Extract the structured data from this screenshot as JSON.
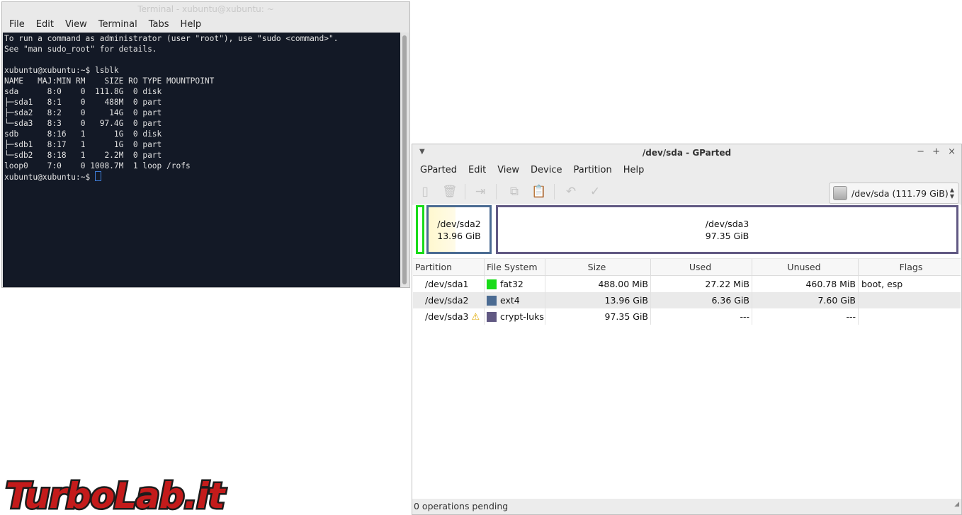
{
  "terminal": {
    "title": "Terminal - xubuntu@xubuntu: ~",
    "menu": [
      "File",
      "Edit",
      "View",
      "Terminal",
      "Tabs",
      "Help"
    ],
    "lines": [
      "To run a command as administrator (user \"root\"), use \"sudo <command>\".",
      "See \"man sudo_root\" for details.",
      "",
      "xubuntu@xubuntu:~$ lsblk",
      "NAME   MAJ:MIN RM    SIZE RO TYPE MOUNTPOINT",
      "sda      8:0    0  111.8G  0 disk",
      "├─sda1   8:1    0    488M  0 part",
      "├─sda2   8:2    0     14G  0 part",
      "└─sda3   8:3    0   97.4G  0 part",
      "sdb      8:16   1      1G  0 disk",
      "├─sdb1   8:17   1      1G  0 part",
      "└─sdb2   8:18   1    2.2M  0 part",
      "loop0    7:0    0 1008.7M  1 loop /rofs"
    ],
    "prompt": "xubuntu@xubuntu:~$ "
  },
  "gparted": {
    "title": "/dev/sda - GParted",
    "menu": [
      "GParted",
      "Edit",
      "View",
      "Device",
      "Partition",
      "Help"
    ],
    "toolbar_icons": [
      "new-icon",
      "delete-icon",
      "resize-move-icon",
      "copy-icon",
      "paste-icon",
      "undo-icon",
      "apply-icon"
    ],
    "device_selector": "/dev/sda   (111.79 GiB)",
    "graph": {
      "sda2": {
        "name": "/dev/sda2",
        "size": "13.96 GiB"
      },
      "sda3": {
        "name": "/dev/sda3",
        "size": "97.35 GiB"
      }
    },
    "colors": {
      "fat32": "#18db18",
      "ext4": "#4b6b92",
      "crypt-luks": "#615983",
      "selection": "#fff6c8"
    },
    "columns": [
      "Partition",
      "File System",
      "Size",
      "Used",
      "Unused",
      "Flags"
    ],
    "rows": [
      {
        "partition": "/dev/sda1",
        "fs": "fat32",
        "size": "488.00 MiB",
        "used": "27.22 MiB",
        "unused": "460.78 MiB",
        "flags": "boot, esp",
        "warning": false
      },
      {
        "partition": "/dev/sda2",
        "fs": "ext4",
        "size": "13.96 GiB",
        "used": "6.36 GiB",
        "unused": "7.60 GiB",
        "flags": "",
        "warning": false
      },
      {
        "partition": "/dev/sda3",
        "fs": "crypt-luks",
        "size": "97.35 GiB",
        "used": "---",
        "unused": "---",
        "flags": "",
        "warning": true
      }
    ],
    "status": "0 operations pending"
  },
  "watermark": "TurboLab.it"
}
